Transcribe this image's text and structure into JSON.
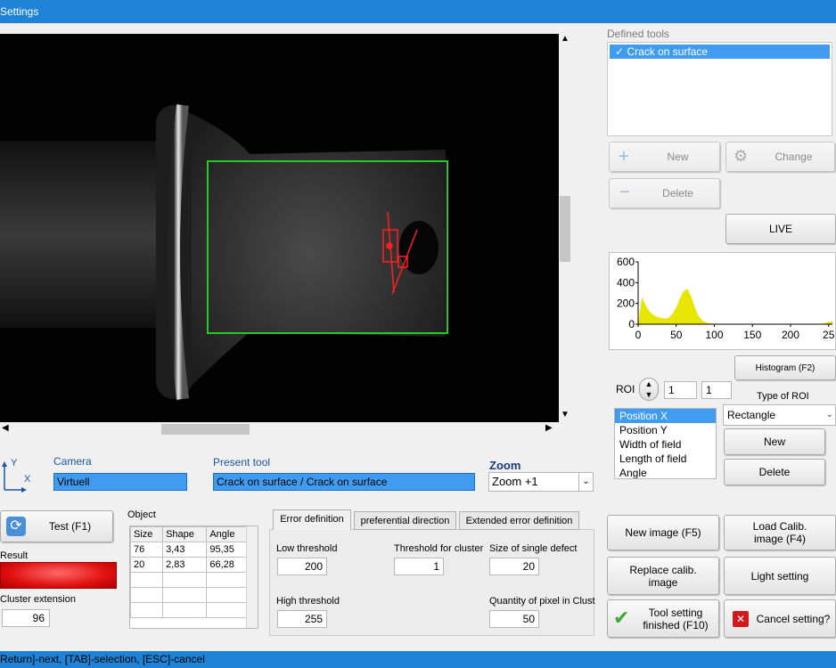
{
  "window": {
    "title": "Settings"
  },
  "status": {
    "text": "Return]-next, [TAB]-selection, [ESC]-cancel"
  },
  "defined_tools": {
    "title": "Defined tools",
    "items": [
      {
        "label": "Crack on surface",
        "checked": true
      }
    ],
    "new_label": "New",
    "change_label": "Change",
    "delete_label": "Delete",
    "live_label": "LIVE"
  },
  "histogram": {
    "button_label": "Histogram (F2)",
    "y_ticks": [
      "600",
      "400",
      "200",
      "0"
    ],
    "x_ticks": [
      "0",
      "50",
      "100",
      "150",
      "200",
      "25"
    ]
  },
  "chart_data": {
    "type": "area",
    "xlim": [
      0,
      255
    ],
    "ylim": [
      0,
      600
    ],
    "x": [
      0,
      5,
      10,
      15,
      20,
      25,
      30,
      35,
      40,
      45,
      50,
      55,
      60,
      65,
      70,
      75,
      80,
      85,
      90,
      95,
      100,
      110,
      120,
      140,
      160,
      180,
      200,
      220,
      240,
      255
    ],
    "values": [
      0,
      260,
      180,
      120,
      90,
      70,
      60,
      55,
      60,
      100,
      160,
      250,
      320,
      340,
      260,
      150,
      70,
      30,
      15,
      8,
      5,
      3,
      2,
      1,
      1,
      0,
      0,
      0,
      0,
      30
    ]
  },
  "roi": {
    "label": "ROI",
    "value1": "1",
    "value2": "1",
    "type_label": "Type of ROI",
    "type_value": "Rectangle",
    "params": [
      "Position X",
      "Position Y",
      "Width of field",
      "Length of field",
      "Angle"
    ],
    "selected_param": "Position X",
    "new_label": "New",
    "delete_label": "Delete"
  },
  "camera": {
    "label": "Camera",
    "value": "Virtuell"
  },
  "present_tool": {
    "label": "Present tool",
    "value": "Crack on surface / Crack on surface"
  },
  "zoom": {
    "label": "Zoom",
    "value": "Zoom +1"
  },
  "axes": {
    "y": "Y",
    "x": "X"
  },
  "test": {
    "label": "Test (F1)",
    "result_label": "Result",
    "cluster_label": "Cluster extension",
    "cluster_value": "96"
  },
  "object_table": {
    "title": "Object",
    "headers": [
      "Size",
      "Shape",
      "Angle"
    ],
    "rows": [
      [
        "76",
        "3,43",
        "95,35"
      ],
      [
        "20",
        "2,83",
        "66,28"
      ]
    ]
  },
  "tabs": [
    "Error definition",
    "preferential direction",
    "Extended error definition"
  ],
  "error_def": {
    "low_threshold_label": "Low threshold",
    "low_threshold": "200",
    "cluster_threshold_label": "Threshold for cluster",
    "cluster_threshold": "1",
    "single_defect_label": "Size of single defect",
    "single_defect": "20",
    "high_threshold_label": "High threshold",
    "high_threshold": "255",
    "quantity_label": "Quantity of pixel in Clust",
    "quantity": "50"
  },
  "actions": {
    "new_image": "New image (F5)",
    "load_calib": "Load Calib. image (F4)",
    "replace_calib": "Replace calib. image",
    "light_setting": "Light setting",
    "tool_finished": "Tool setting finished (F10)",
    "cancel_setting": "Cancel setting?"
  },
  "colors": {
    "titlebar": "#1e83d6",
    "selection": "#3f9cf0",
    "roi_box": "#22cc22",
    "defect": "#ff2020",
    "histogram_fill": "#e6e600",
    "result_bar": "#e01010"
  }
}
